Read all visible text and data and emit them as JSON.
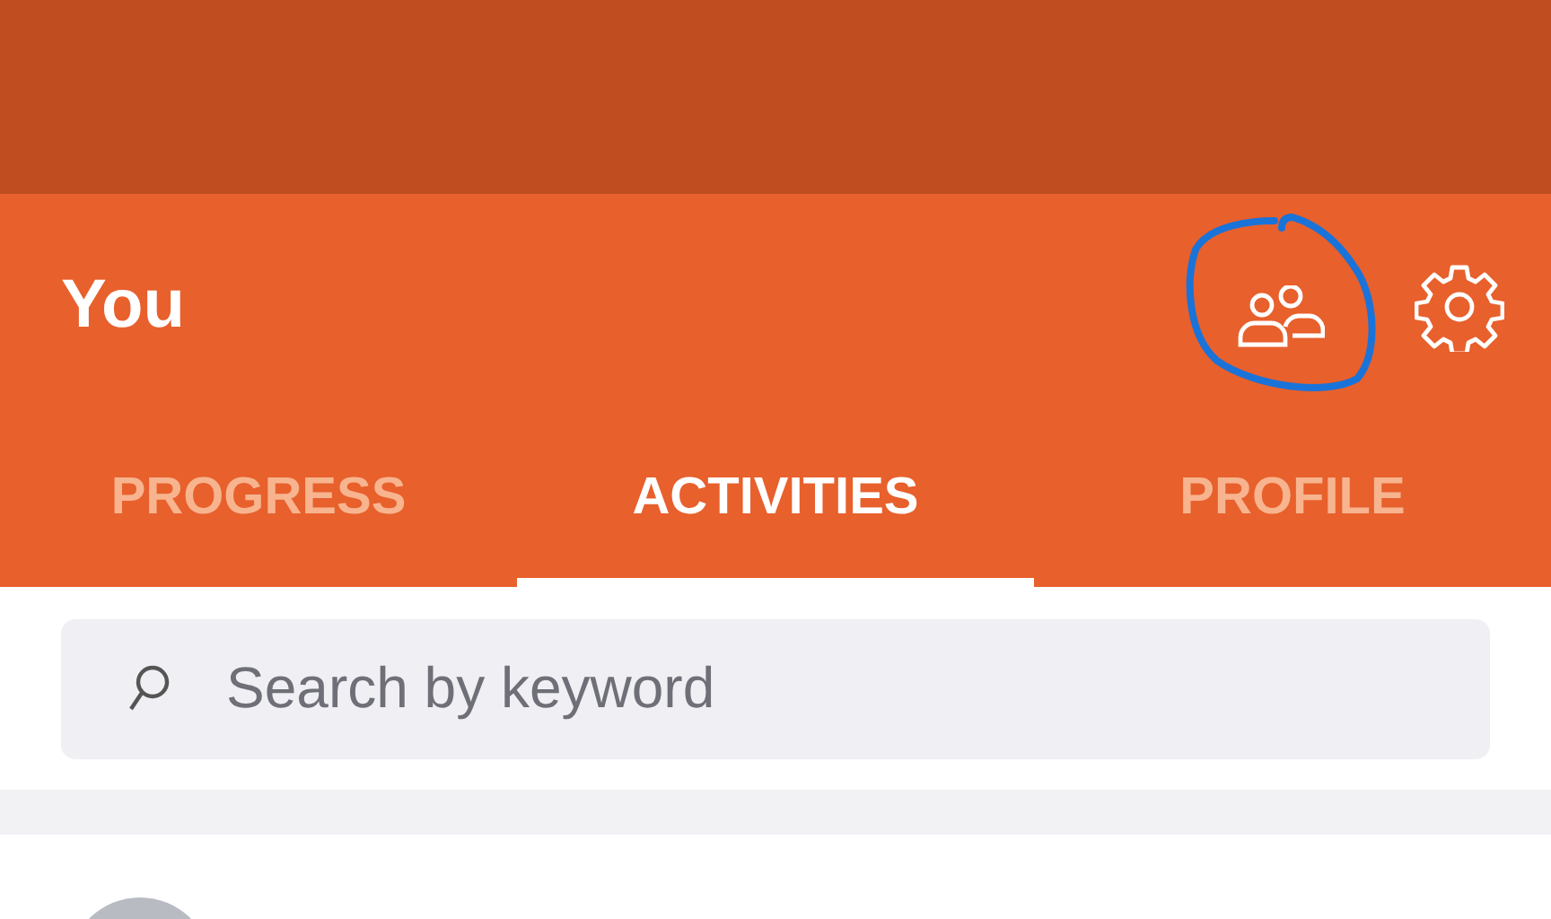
{
  "header": {
    "title": "You"
  },
  "tabs": [
    {
      "label": "PROGRESS",
      "selected": false
    },
    {
      "label": "ACTIVITIES",
      "selected": true
    },
    {
      "label": "PROFILE",
      "selected": false
    }
  ],
  "search": {
    "placeholder": "Search by keyword"
  }
}
